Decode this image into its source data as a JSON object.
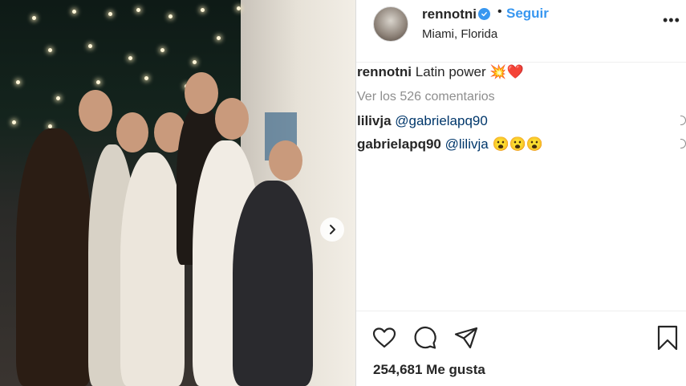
{
  "header": {
    "username": "rennotni",
    "follow_label": "Seguir",
    "separator": "•",
    "location": "Miami, Florida",
    "more_label": "•••"
  },
  "caption": {
    "username": "rennotni",
    "text": "Latin power",
    "emojis": "💥❤️"
  },
  "view_comments": "Ver los 526 comentarios",
  "comments": [
    {
      "username": "lilivja",
      "mention": "@gabrielapq90",
      "emojis": ""
    },
    {
      "username": "gabrielapq90",
      "mention": "@lilivja",
      "emojis": "😮😮😮"
    }
  ],
  "likes": "254,681 Me gusta",
  "colors": {
    "accent": "#3897f0",
    "text": "#262626",
    "muted": "#8e8e8e",
    "mention": "#00376b"
  },
  "icons": [
    "chevron-right-icon",
    "verified-icon",
    "heart-icon",
    "comment-icon",
    "share-icon",
    "bookmark-icon"
  ]
}
